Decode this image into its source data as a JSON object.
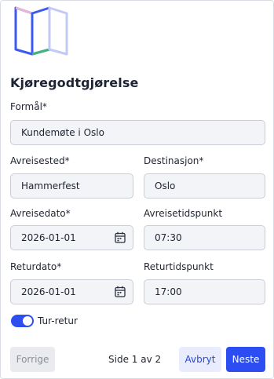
{
  "form": {
    "title": "Kjøregodtgjørelse",
    "purpose_label": "Formål*",
    "purpose_value": "Kundemøte i Oslo",
    "departure_place_label": "Avreisested*",
    "departure_place_value": "Hammerfest",
    "destination_label": "Destinasjon*",
    "destination_value": "Oslo",
    "departure_date_label": "Avreisedato*",
    "departure_date_value": "2026-01-01",
    "departure_time_label": "Avreisetidspunkt",
    "departure_time_value": "07:30",
    "return_date_label": "Returdato*",
    "return_date_value": "2026-01-01",
    "return_time_label": "Returtidspunkt",
    "return_time_value": "17:00",
    "round_trip_label": "Tur-retur",
    "round_trip_on": true
  },
  "footer": {
    "prev_label": "Forrige",
    "page_indicator": "Side 1 av 2",
    "cancel_label": "Avbryt",
    "next_label": "Neste"
  },
  "colors": {
    "primary": "#2b4df1",
    "logo_blue": "#3b5bf0",
    "logo_pink": "#e7b6d6",
    "logo_green": "#3fb67a",
    "logo_lavender": "#c3c9f7"
  },
  "icons": [
    "map-logo-icon",
    "calendar-icon"
  ]
}
